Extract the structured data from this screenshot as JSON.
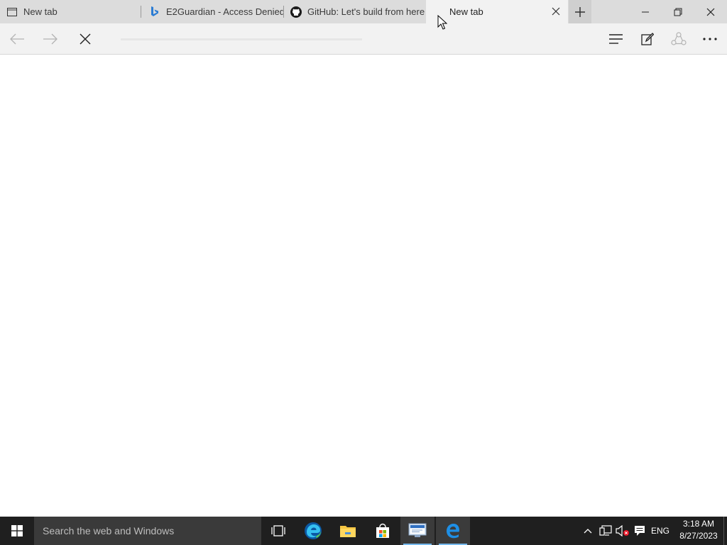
{
  "browser": {
    "tabs": [
      {
        "title": "New tab",
        "icon": "page-icon"
      },
      {
        "title": "E2Guardian - Access Denied",
        "icon": "bing-icon"
      },
      {
        "title": "GitHub: Let's build from here",
        "icon": "github-icon"
      },
      {
        "title": "New tab",
        "icon": "page-icon",
        "active": true
      }
    ],
    "address_value": "",
    "colors": {
      "tab_strip": "#dcdcdc",
      "active_tab": "#f2f2f2",
      "accent": "#0078d7"
    }
  },
  "taskbar": {
    "search_placeholder": "Search the web and Windows",
    "apps": [
      "task-view",
      "edge-chromium",
      "file-explorer",
      "store",
      "remote-desktop",
      "edge-legacy"
    ],
    "language": "ENG",
    "time": "3:18 AM",
    "date": "8/27/2023",
    "colors": {
      "background": "#1f1f1f",
      "search_bg": "#3a3a3a",
      "active_underline": "#76b9ed"
    }
  }
}
